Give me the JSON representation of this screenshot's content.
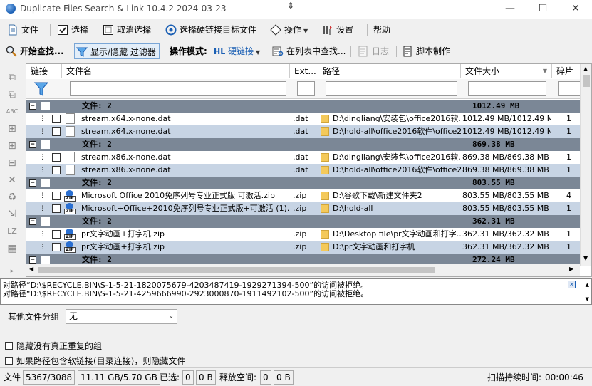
{
  "window": {
    "title": "Duplicate Files Search & Link 10.4.2 2024-03-23",
    "minimize": "—",
    "maximize": "☐",
    "close": "✕"
  },
  "menubar": {
    "file": "文件",
    "select": "选择",
    "deselect": "取消选择",
    "select_hardlink_target": "选择硬链接目标文件",
    "operation": "操作",
    "settings": "设置",
    "help": "帮助"
  },
  "toolbar": {
    "start_search": "开始查找...",
    "toggle_filter": "显示/隐藏 过滤器",
    "op_mode_label": "操作模式:",
    "hardlink_mode": "硬链接",
    "find_in_list": "在列表中查找...",
    "log": "日志",
    "script": "脚本制作"
  },
  "grid": {
    "headers": {
      "link": "链接",
      "filename": "文件名",
      "ext": "Ext...",
      "path": "路径",
      "size": "文件大小",
      "frag": "碎片"
    },
    "groups": [
      {
        "label": "文件: 2",
        "size": "1012.49 MB",
        "rows": [
          {
            "name": "stream.x64.x-none.dat",
            "ext": ".dat",
            "path": "D:\\dingliang\\安装包\\office2016软...",
            "size": "1012.49 MB/1012.49 MB",
            "frag": "1",
            "icon": "file"
          },
          {
            "name": "stream.x64.x-none.dat",
            "ext": ".dat",
            "path": "D:\\hold-all\\office2016软件\\office2...",
            "size": "1012.49 MB/1012.49 MB",
            "frag": "1",
            "icon": "file"
          }
        ]
      },
      {
        "label": "文件: 2",
        "size": "869.38 MB",
        "rows": [
          {
            "name": "stream.x86.x-none.dat",
            "ext": ".dat",
            "path": "D:\\dingliang\\安装包\\office2016软...",
            "size": "869.38 MB/869.38 MB",
            "frag": "1",
            "icon": "file"
          },
          {
            "name": "stream.x86.x-none.dat",
            "ext": ".dat",
            "path": "D:\\hold-all\\office2016软件\\office2...",
            "size": "869.38 MB/869.38 MB",
            "frag": "1",
            "icon": "file"
          }
        ]
      },
      {
        "label": "文件: 2",
        "size": "803.55 MB",
        "rows": [
          {
            "name": "Microsoft Office 2010免序列号专业正式版 可激活.zip",
            "ext": ".zip",
            "path": "D:\\谷歌下载\\新建文件夹2",
            "size": "803.55 MB/803.55 MB",
            "frag": "4",
            "icon": "zip"
          },
          {
            "name": "Microsoft+Office+2010免序列号专业正式版+可激活 (1).zip",
            "ext": ".zip",
            "path": "D:\\hold-all",
            "size": "803.55 MB/803.55 MB",
            "frag": "1",
            "icon": "zip"
          }
        ]
      },
      {
        "label": "文件: 2",
        "size": "362.31 MB",
        "rows": [
          {
            "name": "pr文字动画+打字机.zip",
            "ext": ".zip",
            "path": "D:\\Desktop file\\pr文字动画和打字...",
            "size": "362.31 MB/362.32 MB",
            "frag": "1",
            "icon": "zip"
          },
          {
            "name": "pr文字动画+打字机.zip",
            "ext": ".zip",
            "path": "D:\\pr文字动画和打字机",
            "size": "362.31 MB/362.32 MB",
            "frag": "1",
            "icon": "zip"
          }
        ]
      },
      {
        "label": "文件: 2",
        "size": "272.24 MB",
        "rows": []
      }
    ]
  },
  "log": {
    "line1": "对路径“D:\\$RECYCLE.BIN\\S-1-5-21-1820075679-4203487419-1929271394-500”的访问被拒绝。",
    "line2": "对路径“D:\\$RECYCLE.BIN\\S-1-5-21-4259666990-2923000870-1911492102-500”的访问被拒绝。"
  },
  "bottom": {
    "other_group_label": "其他文件分组",
    "other_group_value": "无",
    "hide_nondup": "隐藏没有真正重复的组",
    "hide_softlink": "如果路径包含软链接(目录连接)，则隐藏文件"
  },
  "status": {
    "files_label": "文件",
    "files_count": "5367/3088",
    "size": "11.11 GB/5.70 GB",
    "selected_label": "已选:",
    "selected_count": "0",
    "selected_size": "0 B",
    "free_label": "释放空间:",
    "free_count": "0",
    "free_size": "0 B",
    "duration_label": "扫描持续时间:",
    "duration": "00:00:46"
  },
  "colors": {
    "group_row": "#7b8796",
    "alt_row": "#c7d4e4",
    "accent": "#1a5fb4"
  }
}
